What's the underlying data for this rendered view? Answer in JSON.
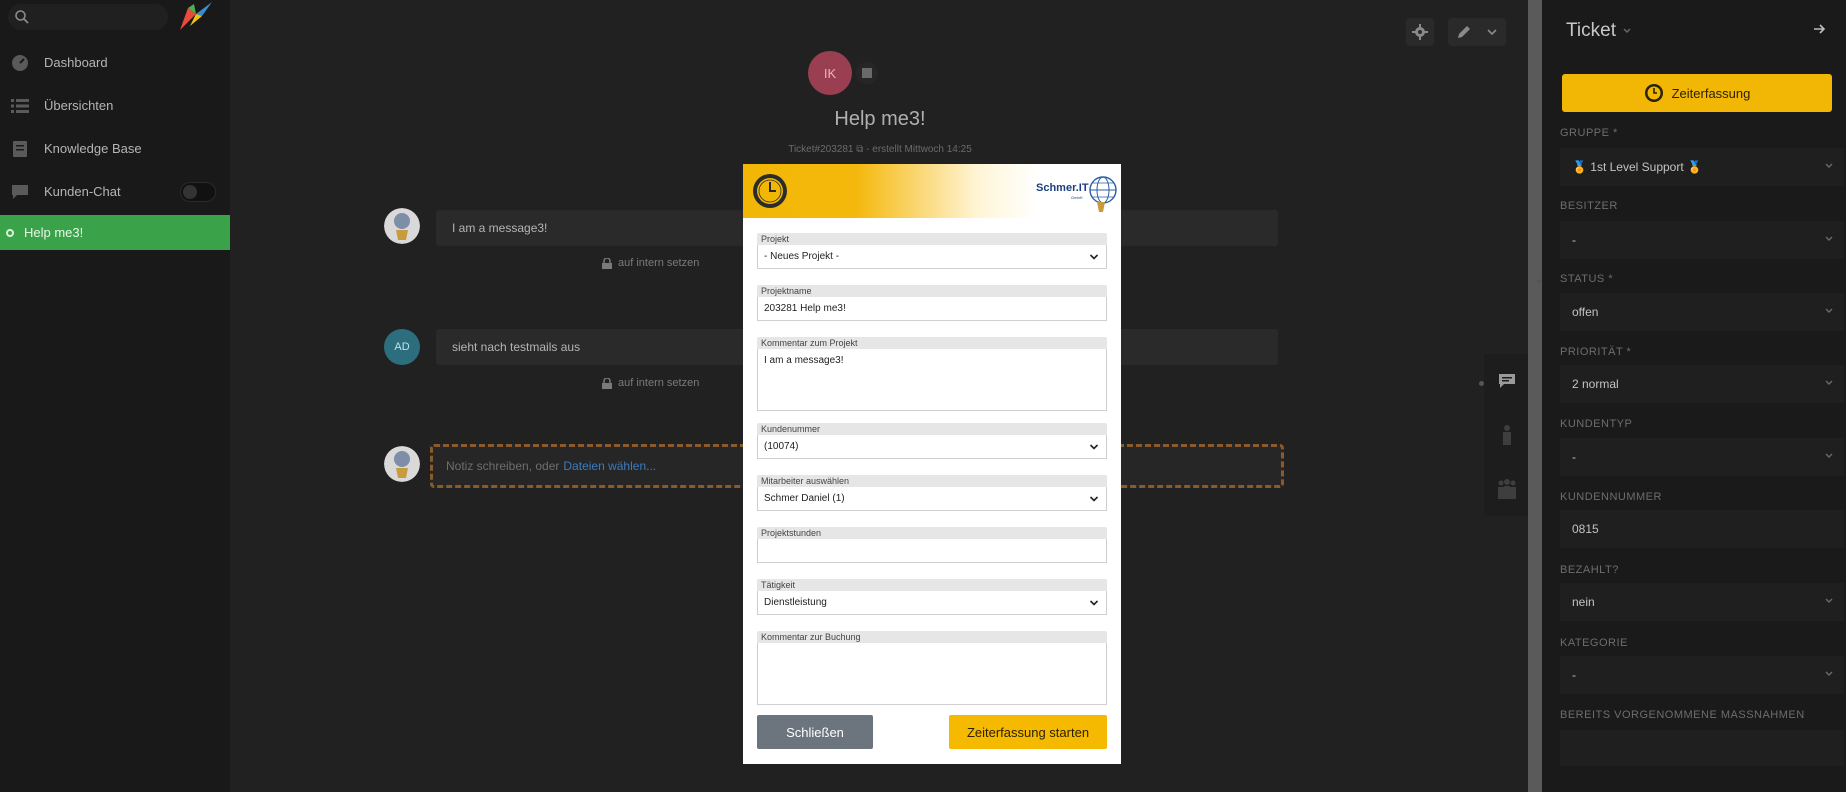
{
  "sidebar": {
    "search_placeholder": "",
    "items": [
      {
        "label": "Dashboard",
        "icon": "dashboard-icon"
      },
      {
        "label": "Übersichten",
        "icon": "list-icon"
      },
      {
        "label": "Knowledge Base",
        "icon": "book-icon"
      },
      {
        "label": "Kunden-Chat",
        "icon": "chat-icon"
      }
    ],
    "active_tab": "Help me3!"
  },
  "main": {
    "avatar_initials": "IK",
    "title": "Help me3!",
    "meta_ticket": "Ticket#203281",
    "meta_created": "- erstellt Mittwoch 14:25",
    "messages": [
      {
        "text": "I am a message3!",
        "internal": "auf intern setzen"
      },
      {
        "text": "sieht nach testmails aus",
        "internal": "auf intern setzen",
        "avatar": "AD"
      }
    ],
    "note_placeholder": "Notiz schreiben, oder",
    "note_link": "Dateien wählen..."
  },
  "right_panel": {
    "title": "Ticket",
    "time_button": "Zeiterfassung",
    "fields": [
      {
        "label": "GRUPPE *",
        "value": "🏅 1st Level Support 🏅"
      },
      {
        "label": "BESITZER",
        "value": "-"
      },
      {
        "label": "STATUS *",
        "value": "offen"
      },
      {
        "label": "PRIORITÄT *",
        "value": "2 normal"
      },
      {
        "label": "KUNDENTYP",
        "value": "-"
      },
      {
        "label": "KUNDENNUMMER",
        "value": "0815"
      },
      {
        "label": "BEZAHLT?",
        "value": "nein"
      },
      {
        "label": "KATEGORIE",
        "value": "-"
      },
      {
        "label": "BEREITS VORGENOMMENE MASSNAHMEN",
        "value": ""
      }
    ]
  },
  "modal": {
    "brand_name": "Schmer.IT",
    "brand_sub": "GmbH",
    "fields": [
      {
        "label": "Projekt",
        "value": "- Neues Projekt -"
      },
      {
        "label": "Projektname",
        "value": "203281 Help me3!"
      },
      {
        "label": "Kommentar zum Projekt",
        "value": "I am a message3!"
      },
      {
        "label": "Kundenummer",
        "value": "(10074)"
      },
      {
        "label": "Mitarbeiter auswählen",
        "value": "Schmer Daniel (1)"
      },
      {
        "label": "Projektstunden",
        "value": ""
      },
      {
        "label": "Tätigkeit",
        "value": "Dienstleistung"
      },
      {
        "label": "Kommentar zur Buchung",
        "value": ""
      }
    ],
    "close_button": "Schließen",
    "start_button": "Zeiterfassung starten"
  },
  "colors": {
    "accent_yellow": "#f2b705",
    "active_green": "#3aa34a",
    "close_gray": "#6c757d"
  }
}
